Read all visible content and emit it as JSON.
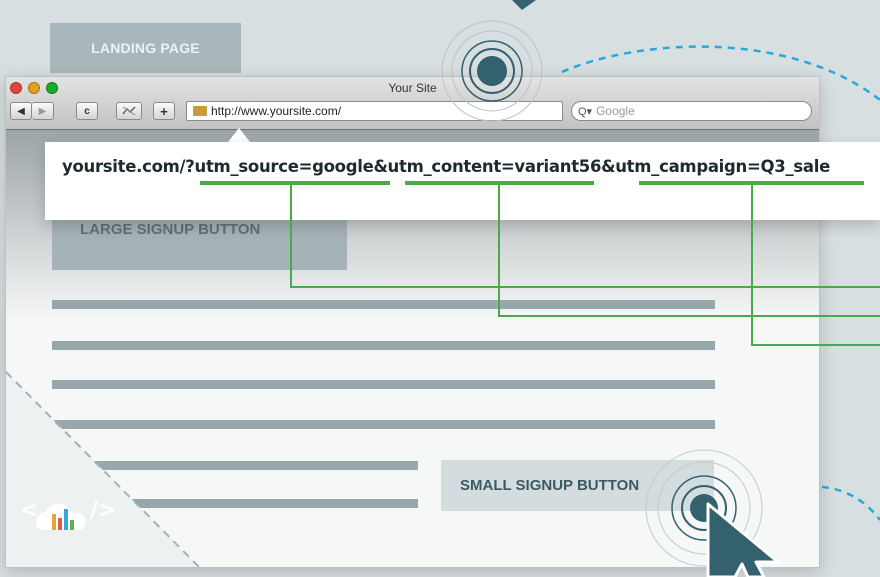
{
  "landing_label": "LANDING PAGE",
  "browser": {
    "title": "Your Site",
    "url": "http://www.yoursite.com/",
    "search_placeholder": "Google",
    "search_glyph": "Q▾",
    "back_icon": "◀",
    "forward_icon": "▶",
    "reload_icon": "c",
    "add_icon": "+"
  },
  "url_popup": {
    "text": "yoursite.com/?utm_source=google&utm_content=variant56&utm_campaign=Q3_sale"
  },
  "large_signup": "LARGE  SIGNUP BUTTON",
  "small_signup": "SMALL SIGNUP BUTTON",
  "logo": {
    "left": "<",
    "right": "/>"
  },
  "colors": {
    "accent_green": "#4aaa4a",
    "dashed_blue": "#29a8e0",
    "target_teal": "#33616e",
    "placeholder_gray": "#98a7ac"
  }
}
